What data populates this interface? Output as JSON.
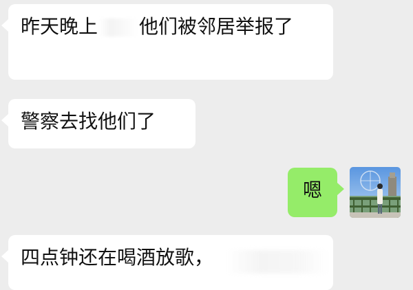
{
  "chat": {
    "messages": [
      {
        "side": "incoming",
        "text_before": "昨天晚上",
        "text_after": "他们被邻居举报了",
        "redacted": true
      },
      {
        "side": "incoming",
        "text": "警察去找他们了"
      },
      {
        "side": "outgoing",
        "text": "嗯"
      },
      {
        "side": "incoming",
        "text": "四点钟还在喝酒放歌，",
        "redacted_tail": true
      }
    ],
    "avatar": {
      "icon": "user-avatar-photo",
      "description_colors": {
        "sky": "#6fa8e8",
        "railing": "#4a6a3a",
        "figure": "#f2efe8"
      }
    },
    "colors": {
      "background": "#ededed",
      "incoming_bubble": "#ffffff",
      "outgoing_bubble": "#95ec69",
      "text": "#111111"
    }
  }
}
